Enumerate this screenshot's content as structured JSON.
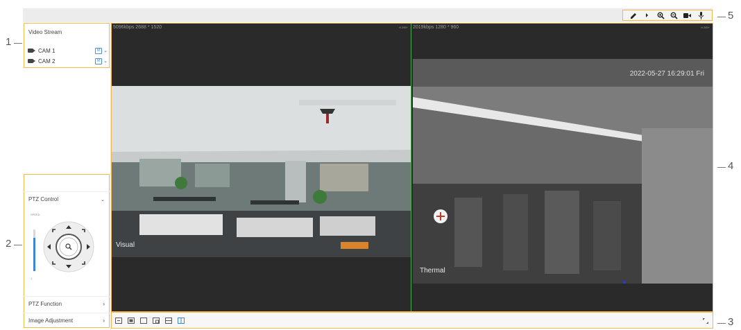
{
  "video_stream": {
    "title": "Video Stream",
    "cameras": [
      {
        "label": "CAM 1",
        "stream": "M"
      },
      {
        "label": "CAM 2",
        "stream": "M"
      }
    ]
  },
  "ptz": {
    "control_label": "PTZ Control",
    "speed_max": "SPEED",
    "speed_min": "1",
    "speed_level_fraction": 0.8,
    "function_label": "PTZ Function",
    "image_adjust_label": "Image Adjustment"
  },
  "views": {
    "visual": {
      "info": "5096kbps  2688 * 1520",
      "tag": "H.265+",
      "label": "Visual"
    },
    "thermal": {
      "info": "2019kbps  1280 * 960",
      "tag": "H.265+",
      "label": "Thermal",
      "timestamp": "2022-05-27 16:29:01 Fri"
    }
  },
  "callouts": [
    "1",
    "2",
    "3",
    "4",
    "5"
  ],
  "colors": {
    "annotation": "#f2b84b",
    "accent": "#3a87d6",
    "divider": "#4caf50"
  },
  "icons": {
    "top_tools": [
      "pencil-icon",
      "zoom-in-icon",
      "zoom-out-icon",
      "record-icon",
      "audio-icon"
    ],
    "split_modes": [
      "split-1-icon",
      "split-2-icon",
      "split-3-icon",
      "split-4-icon",
      "split-5-icon",
      "split-6-icon"
    ],
    "fullscreen": "fullscreen-icon"
  }
}
